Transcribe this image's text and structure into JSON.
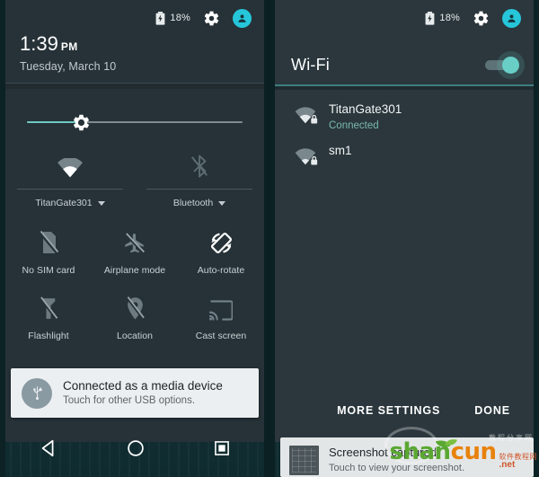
{
  "left_panel": {
    "status": {
      "battery_icon": "battery-charging-icon",
      "battery_level": "18%",
      "settings_icon": "gear-icon",
      "user_icon": "user-avatar-icon"
    },
    "clock": {
      "time": "1:39",
      "ampm": "PM",
      "date": "Tuesday, March 10"
    },
    "brightness": {
      "icon": "brightness-gear-icon",
      "value_pct": 23
    },
    "detail_tiles": [
      {
        "icon": "wifi-icon",
        "label": "TitanGate301",
        "caret": "chevron-down-icon",
        "state": "on"
      },
      {
        "icon": "bluetooth-off-icon",
        "label": "Bluetooth",
        "caret": "chevron-down-icon",
        "state": "off"
      }
    ],
    "tiles_row2": [
      {
        "icon": "sim-card-off-icon",
        "label": "No SIM card"
      },
      {
        "icon": "airplane-off-icon",
        "label": "Airplane mode"
      },
      {
        "icon": "auto-rotate-icon",
        "label": "Auto-rotate"
      }
    ],
    "tiles_row3": [
      {
        "icon": "flashlight-off-icon",
        "label": "Flashlight"
      },
      {
        "icon": "location-off-icon",
        "label": "Location"
      },
      {
        "icon": "cast-screen-icon",
        "label": "Cast screen"
      }
    ],
    "notification": {
      "icon": "usb-icon",
      "title": "Connected as a media device",
      "subtitle": "Touch for other USB options."
    },
    "navbar": {
      "back": "back-triangle-icon",
      "home": "home-circle-icon",
      "recents": "recents-square-icon"
    }
  },
  "right_panel": {
    "status": {
      "battery_icon": "battery-charging-icon",
      "battery_level": "18%",
      "settings_icon": "gear-icon",
      "user_icon": "user-avatar-icon"
    },
    "header": {
      "title": "Wi-Fi",
      "toggle_state": "on"
    },
    "networks": [
      {
        "icon": "wifi-lock-icon",
        "ssid": "TitanGate301",
        "state": "Connected"
      },
      {
        "icon": "wifi-lock-icon",
        "ssid": "sm1",
        "state": ""
      }
    ],
    "buttons": {
      "more_settings": "MORE SETTINGS",
      "done": "DONE"
    },
    "notification": {
      "icon": "screenshot-thumbnail",
      "title": "Screenshot captured.",
      "subtitle": "Touch to view your screenshot."
    }
  },
  "watermark": {
    "brand_part1": "shan",
    "brand_part2": "cun",
    "suffix": ".net",
    "cn_text": "软件教程网",
    "top_text": "教程分享网"
  },
  "colors": {
    "panel_bg": "#263238",
    "panel_bg_right": "#2b373d",
    "accent_teal": "#69cfc6",
    "accent_cyan": "#26c6da",
    "divider_teal": "#3c7f7d",
    "text_primary": "#ffffff",
    "text_secondary": "#c9d1d4",
    "connected_green": "#79b9ae",
    "brand_green": "#5aa832",
    "brand_orange": "#e8820c"
  }
}
